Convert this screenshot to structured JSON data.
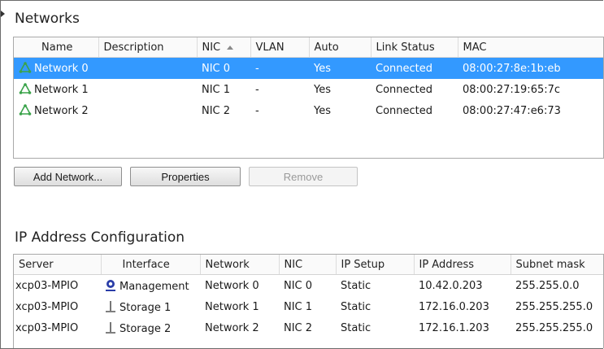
{
  "networks": {
    "title": "Networks",
    "columns": [
      "Name",
      "Description",
      "NIC",
      "VLAN",
      "Auto",
      "Link Status",
      "MAC"
    ],
    "sorted_column": "NIC",
    "rows": [
      {
        "name": "Network 0",
        "description": "",
        "nic": "NIC 0",
        "vlan": "-",
        "auto": "Yes",
        "link_status": "Connected",
        "mac": "08:00:27:8e:1b:eb",
        "selected": true
      },
      {
        "name": "Network 1",
        "description": "",
        "nic": "NIC 1",
        "vlan": "-",
        "auto": "Yes",
        "link_status": "Connected",
        "mac": "08:00:27:19:65:7c",
        "selected": false
      },
      {
        "name": "Network 2",
        "description": "",
        "nic": "NIC 2",
        "vlan": "-",
        "auto": "Yes",
        "link_status": "Connected",
        "mac": "08:00:27:47:e6:73",
        "selected": false
      }
    ],
    "buttons": {
      "add": "Add Network...",
      "properties": "Properties",
      "remove": "Remove"
    }
  },
  "ip_config": {
    "title": "IP Address Configuration",
    "columns": [
      "Server",
      "Interface",
      "Network",
      "NIC",
      "IP Setup",
      "IP Address",
      "Subnet mask"
    ],
    "rows": [
      {
        "server": "xcp03-MPIO",
        "interface": "Management",
        "interface_icon": "management-icon",
        "network": "Network 0",
        "nic": "NIC 0",
        "ip_setup": "Static",
        "ip_address": "10.42.0.203",
        "subnet_mask": "255.255.0.0"
      },
      {
        "server": "xcp03-MPIO",
        "interface": "Storage 1",
        "interface_icon": "storage-icon",
        "network": "Network 1",
        "nic": "NIC 1",
        "ip_setup": "Static",
        "ip_address": "172.16.0.203",
        "subnet_mask": "255.255.255.0"
      },
      {
        "server": "xcp03-MPIO",
        "interface": "Storage 2",
        "interface_icon": "storage-icon",
        "network": "Network 2",
        "nic": "NIC 2",
        "ip_setup": "Static",
        "ip_address": "172.16.1.203",
        "subnet_mask": "255.255.255.0"
      }
    ]
  },
  "colors": {
    "selection": "#3399ff",
    "network_icon": "#3aa34a",
    "management_icon": "#2a3da8",
    "storage_icon": "#555555"
  }
}
